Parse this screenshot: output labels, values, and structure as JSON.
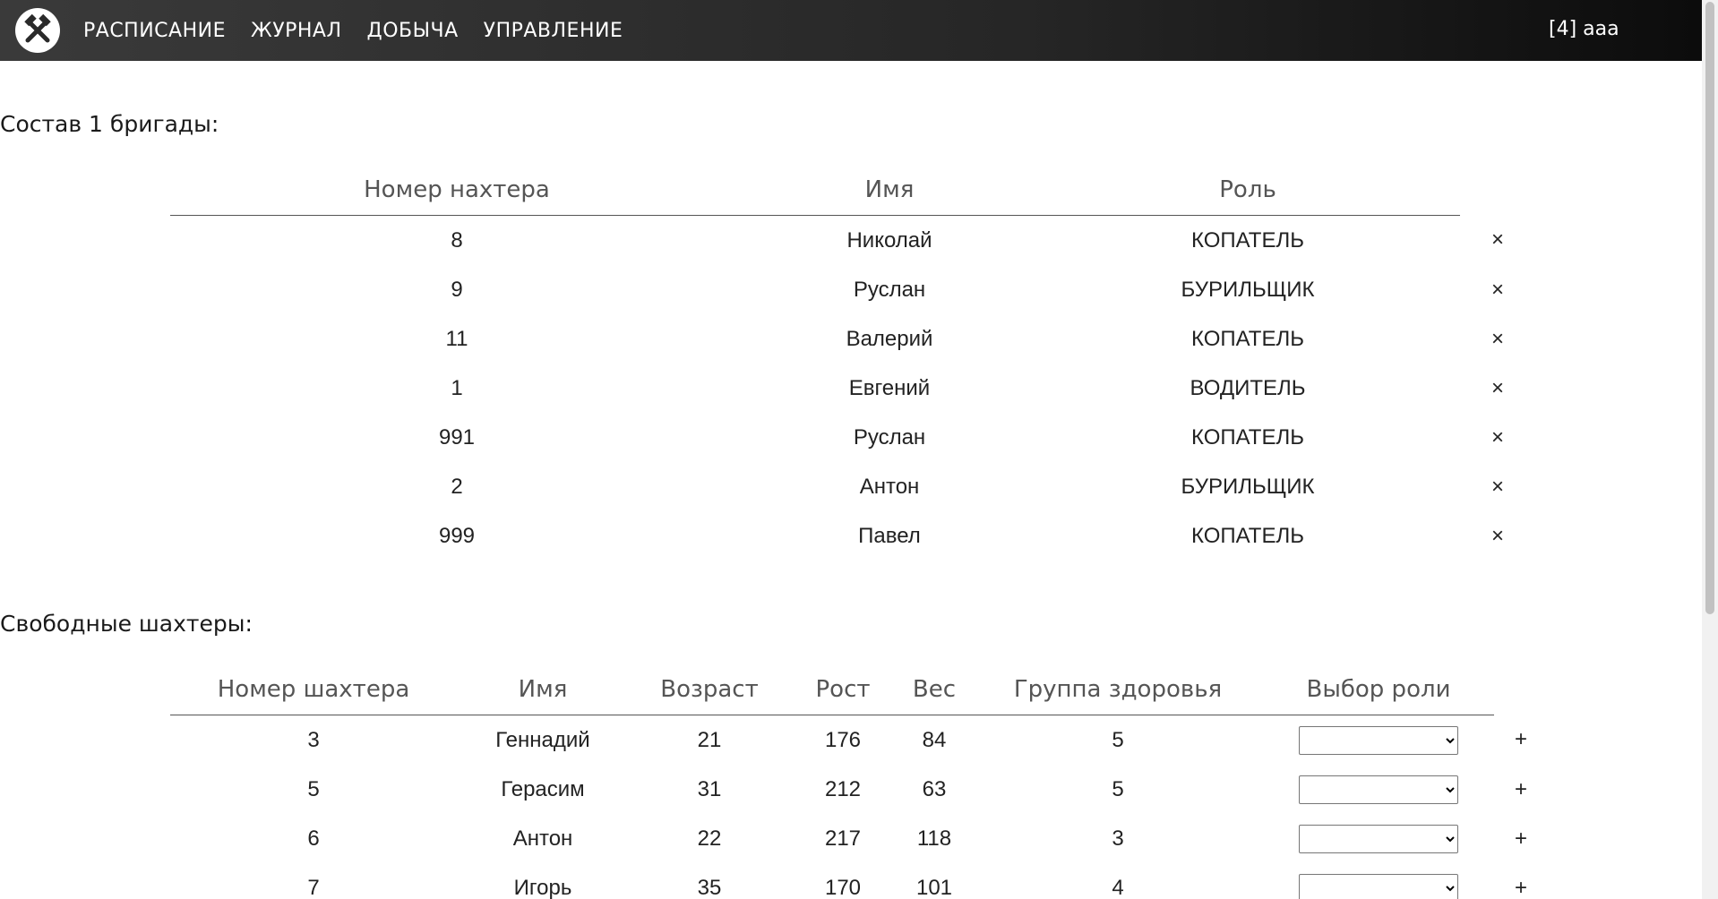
{
  "nav": {
    "logo_icon": "crossed-hammers-icon",
    "items": [
      "РАСПИСАНИЕ",
      "ЖУРНАЛ",
      "ДОБЫЧА",
      "УПРАВЛЕНИЕ"
    ],
    "user": "[4] aaa"
  },
  "brigade": {
    "title": "Состав 1 бригады:",
    "headers": [
      "Номер нахтера",
      "Имя",
      "Роль"
    ],
    "remove_symbol": "×",
    "rows": [
      [
        "8",
        "Николай",
        "КОПАТЕЛЬ"
      ],
      [
        "9",
        "Руслан",
        "БУРИЛЬЩИК"
      ],
      [
        "11",
        "Валерий",
        "КОПАТЕЛЬ"
      ],
      [
        "1",
        "Евгений",
        "ВОДИТЕЛЬ"
      ],
      [
        "991",
        "Руслан",
        "КОПАТЕЛЬ"
      ],
      [
        "2",
        "Антон",
        "БУРИЛЬЩИК"
      ],
      [
        "999",
        "Павел",
        "КОПАТЕЛЬ"
      ]
    ]
  },
  "free_miners": {
    "title": "Свободные шахтеры:",
    "headers": [
      "Номер шахтера",
      "Имя",
      "Возраст",
      "Рост",
      "Вес",
      "Группа здоровья",
      "Выбор роли"
    ],
    "add_symbol": "+",
    "role_selected": "",
    "rows": [
      [
        "3",
        "Геннадий",
        "21",
        "176",
        "84",
        "5"
      ],
      [
        "5",
        "Герасим",
        "31",
        "212",
        "63",
        "5"
      ],
      [
        "6",
        "Антон",
        "22",
        "217",
        "118",
        "3"
      ],
      [
        "7",
        "Игорь",
        "35",
        "170",
        "101",
        "4"
      ]
    ]
  },
  "colors": {
    "navbar_dark": "#0c0c0c",
    "navbar_mid": "#3a3a3a",
    "header_text": "#555555"
  }
}
